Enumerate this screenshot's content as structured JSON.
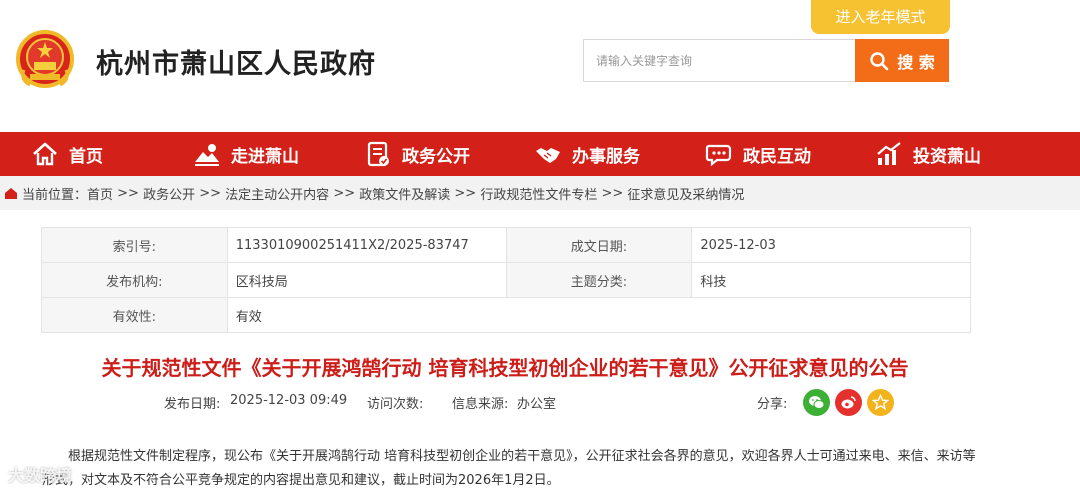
{
  "header": {
    "site_title": "杭州市萧山区人民政府",
    "elder_mode_label": "进入老年模式",
    "search_placeholder": "请输入关键字查询",
    "search_button_label": "搜 索",
    "accent_color": "#d32019",
    "search_color": "#f36d19",
    "elder_color": "#f7c232"
  },
  "nav": {
    "items": [
      {
        "label": "首页",
        "icon": "home-icon"
      },
      {
        "label": "走进萧山",
        "icon": "landscape-icon"
      },
      {
        "label": "政务公开",
        "icon": "document-icon"
      },
      {
        "label": "办事服务",
        "icon": "handshake-icon"
      },
      {
        "label": "政民互动",
        "icon": "chat-icon"
      },
      {
        "label": "投资萧山",
        "icon": "chart-icon"
      }
    ]
  },
  "breadcrumb": {
    "prefix": "当前位置：",
    "items": [
      "首页",
      "政务公开",
      "法定主动公开内容",
      "政策文件及解读",
      "行政规范性文件专栏",
      "征求意见及采纳情况"
    ],
    "separator": " >> "
  },
  "meta": {
    "index_no_label": "索引号:",
    "index_no": "1133010900251411X2/2025-83747",
    "date_label": "成文日期:",
    "date": "2025-12-03",
    "publisher_label": "发布机构:",
    "publisher": "区科技局",
    "topic_label": "主题分类:",
    "topic": "科技",
    "validity_label": "有效性:",
    "validity": "有效"
  },
  "article": {
    "title": "关于规范性文件《关于开展鸿鹄行动 培育科技型初创企业的若干意见》公开征求意见的公告",
    "publish_date_label": "发布日期:",
    "publish_date": "2025-12-03 09:49",
    "visits_label": "访问次数:",
    "source_label": "信息来源:",
    "source": "办公室",
    "share_label": "分享:",
    "body": "根据规范性文件制定程序，现公布《关于开展鸿鹄行动 培育科技型初创企业的若干意见》，公开征求社会各界的意见，欢迎各界人士可通过来电、来信、来访等形式，对文本及不符合公平竞争规定的内容提出意见和建议，截止时间为2026年1月2日。"
  },
  "watermark": "大数跨境"
}
